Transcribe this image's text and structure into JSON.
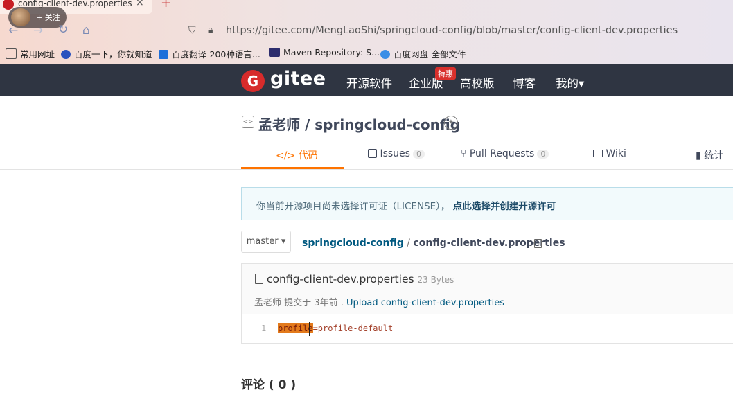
{
  "browser": {
    "tab_title": "config-client-dev.properties",
    "tab_close": "×",
    "new_tab": "+",
    "follow_label": "+ 关注",
    "url": "https://gitee.com/MengLaoShi/springcloud-config/blob/master/config-client-dev.properties",
    "bookmarks": [
      "常用网址",
      "百度一下，你就知道",
      "百度翻译-200种语言...",
      "Maven Repository: S...",
      "百度网盘-全部文件"
    ]
  },
  "gitee": {
    "logo_text": "gitee",
    "nav": [
      "开源软件",
      "企业版",
      "高校版",
      "博客",
      "我的▾"
    ],
    "enterprise_badge": "特惠"
  },
  "repo": {
    "owner": "孟老师",
    "separator": "/",
    "name": "springcloud-config",
    "tabs": [
      {
        "label": "代码",
        "prefix": "</>",
        "count": null
      },
      {
        "label": "Issues",
        "count": "0"
      },
      {
        "label": "Pull Requests",
        "count": "0"
      },
      {
        "label": "Wiki",
        "count": null
      },
      {
        "label": "统计",
        "count": null
      }
    ]
  },
  "notice": {
    "text": "你当前开源项目尚未选择许可证（LICENSE），",
    "link": "点此选择并创建开源许可"
  },
  "breadcrumb": {
    "branch": "master ▾",
    "repo": "springcloud-config",
    "sep": "/",
    "file": "config-client-dev.properties"
  },
  "file": {
    "name": "config-client-dev.properties",
    "size": "23 Bytes",
    "author": "孟老师",
    "commit_text": "提交于",
    "time": "3年前",
    "commit_sep": ".",
    "commit_message": "Upload config-client-dev.properties",
    "lines": [
      {
        "num": "1",
        "key": "profile",
        "rest": "=profile-default"
      }
    ]
  },
  "comments": {
    "title": "评论 ( 0 )"
  },
  "colors": {
    "accent": "#fe7300",
    "header_bg": "#2f3542",
    "link": "#005980"
  }
}
